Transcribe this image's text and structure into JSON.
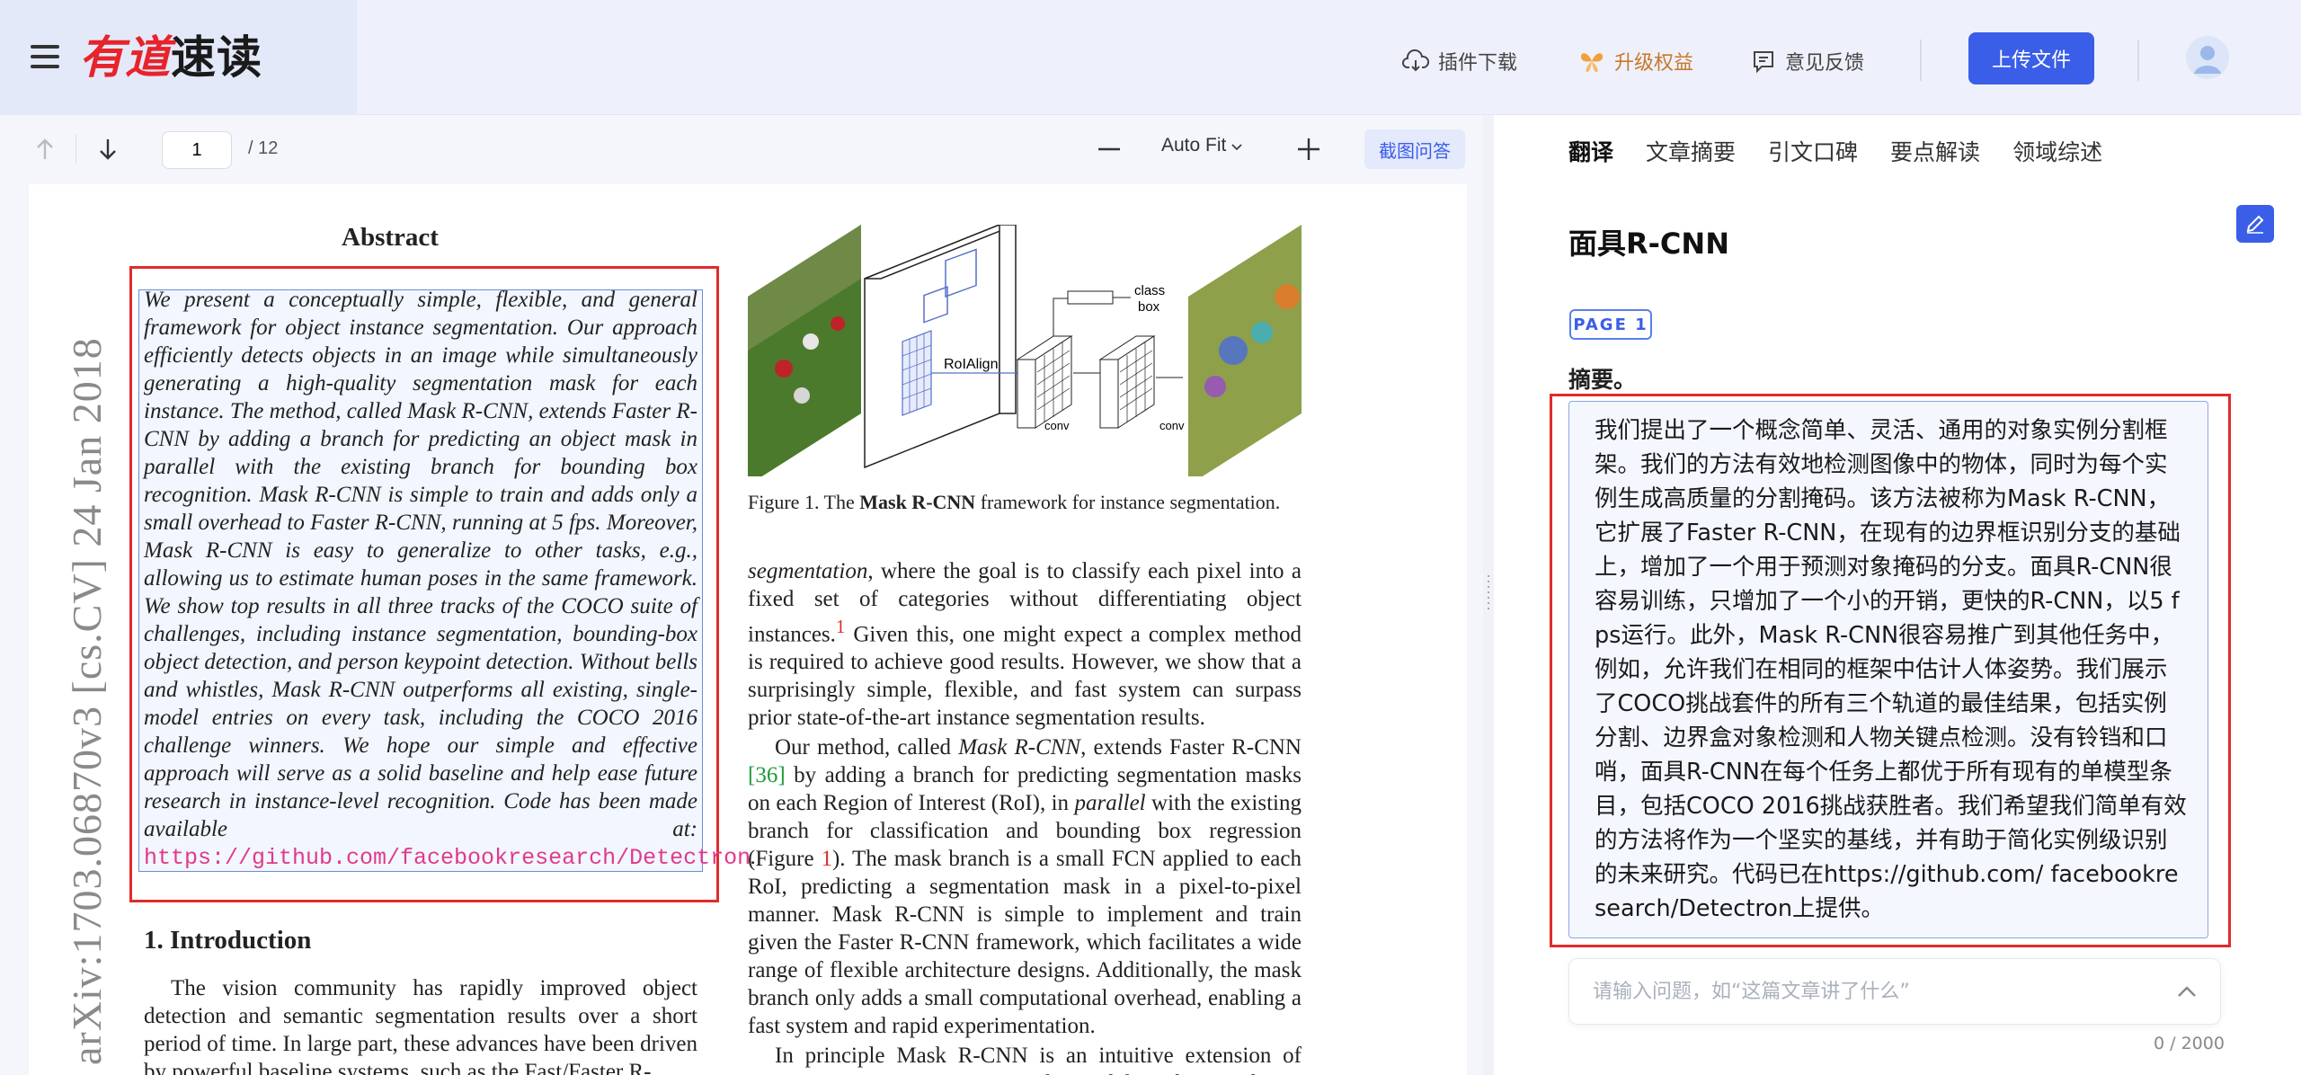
{
  "header": {
    "logo_part1": "有道",
    "logo_part2": "速读",
    "plugin_download": "插件下载",
    "upgrade": "升级权益",
    "feedback": "意见反馈",
    "upload": "上传文件"
  },
  "toolbar": {
    "current_page": "1",
    "total_pages": "/ 12",
    "zoom": "Auto Fit",
    "crop_qa": "截图问答"
  },
  "pdf": {
    "arxiv_id": "arXiv:1703.06870v3  [cs.CV]  24 Jan 2018",
    "abstract_title": "Abstract",
    "abstract_body": "We present a conceptually simple, flexible, and general framework for object instance segmentation. Our approach efficiently detects objects in an image while simultaneously generating a high-quality segmentation mask for each instance. The method, called Mask R-CNN, extends Faster R-CNN by adding a branch for predicting an object mask in parallel with the existing branch for bounding box recognition. Mask R-CNN is simple to train and adds only a small overhead to Faster R-CNN, running at 5 fps. Moreover, Mask R-CNN is easy to generalize to other tasks, e.g., allowing us to estimate human poses in the same framework. We show top results in all three tracks of the COCO suite of challenges, including instance segmentation, bounding-box object detection, and person keypoint detection. Without bells and whistles, Mask R-CNN outperforms all existing, single-model entries on every task, including the COCO 2016 challenge winners. We hope our simple and effective approach will serve as a solid baseline and help ease future research in instance-level recognition. Code has been made available at: ",
    "abstract_link": "https://github.com/facebookresearch/Detectron",
    "intro_title": "1. Introduction",
    "intro_body": "The vision community has rapidly improved object detection and semantic segmentation results over a short period of time. In large part, these advances have been driven by powerful baseline systems, such as the Fast/Faster R-",
    "figure_labels": {
      "roialign": "RoIAlign",
      "conv1": "conv",
      "conv2": "conv",
      "class": "class",
      "box": "box"
    },
    "figure_caption_prefix": "Figure 1. The ",
    "figure_caption_bold": "Mask R-CNN",
    "figure_caption_suffix": " framework for instance segmentation.",
    "col2_p1_a": "segmentation",
    "col2_p1_b": ", where the goal is to classify each pixel into a fixed set of categories without differentiating object instances.",
    "col2_p1_sup": "1",
    "col2_p1_c": " Given this, one might expect a complex method is required to achieve good results. However, we show that a surprisingly simple, flexible, and fast system can surpass prior state-of-the-art instance segmentation results.",
    "col2_p2_a": "Our method, called ",
    "col2_p2_em": "Mask R-CNN",
    "col2_p2_b": ", extends Faster R-CNN ",
    "col2_p2_cite": "[36]",
    "col2_p2_c": " by adding a branch for predicting segmentation masks on each Region of Interest (RoI), in ",
    "col2_p2_em2": "parallel",
    "col2_p2_d": " with the existing branch for classification and bounding box regression (Figure ",
    "col2_p2_fig": "1",
    "col2_p2_e": "). The mask branch is a small FCN applied to each RoI, predicting a segmentation mask in a pixel-to-pixel manner. Mask R-CNN is simple to implement and train given the Faster R-CNN framework, which facilitates a wide range of flexible architecture designs. Additionally, the mask branch only adds a small computational overhead, enabling a fast system and rapid experimentation.",
    "col2_p3": "In principle Mask R-CNN is an intuitive extension of Faster R-CNN, yet constructing the mask branch properly"
  },
  "panel": {
    "tabs": [
      "翻译",
      "文章摘要",
      "引文口碑",
      "要点解读",
      "领域综述"
    ],
    "title": "面具R-CNN",
    "page_badge": "PAGE 1",
    "section": "摘要。",
    "translation": "我们提出了一个概念简单、灵活、通用的对象实例分割框架。我们的方法有效地检测图像中的物体，同时为每个实例生成高质量的分割掩码。该方法被称为Mask R-CNN，它扩展了Faster R-CNN，在现有的边界框识别分支的基础上，增加了一个用于预测对象掩码的分支。面具R-CNN很容易训练，只增加了一个小的开销，更快的R-CNN，以5 fps运行。此外，Mask R-CNN很容易推广到其他任务中，例如，允许我们在相同的框架中估计人体姿势。我们展示了COCO挑战套件的所有三个轨道的最佳结果，包括实例分割、边界盒对象检测和人物关键点检测。没有铃铛和口哨，面具R-CNN在每个任务上都优于所有现有的单模型条目，包括COCO 2016挑战获胜者。我们希望我们简单有效的方法将作为一个坚实的基线，并有助于简化实例级识别的未来研究。代码已在https://github.com/ facebookresearch/Detectron上提供。",
    "question_placeholder": "请输入问题，如“这篇文章讲了什么”",
    "char_count": "0 / 2000"
  },
  "colors": {
    "accent": "#3a5ee8",
    "highlight_red": "#e02b2b",
    "logo_red": "#e8232a"
  }
}
